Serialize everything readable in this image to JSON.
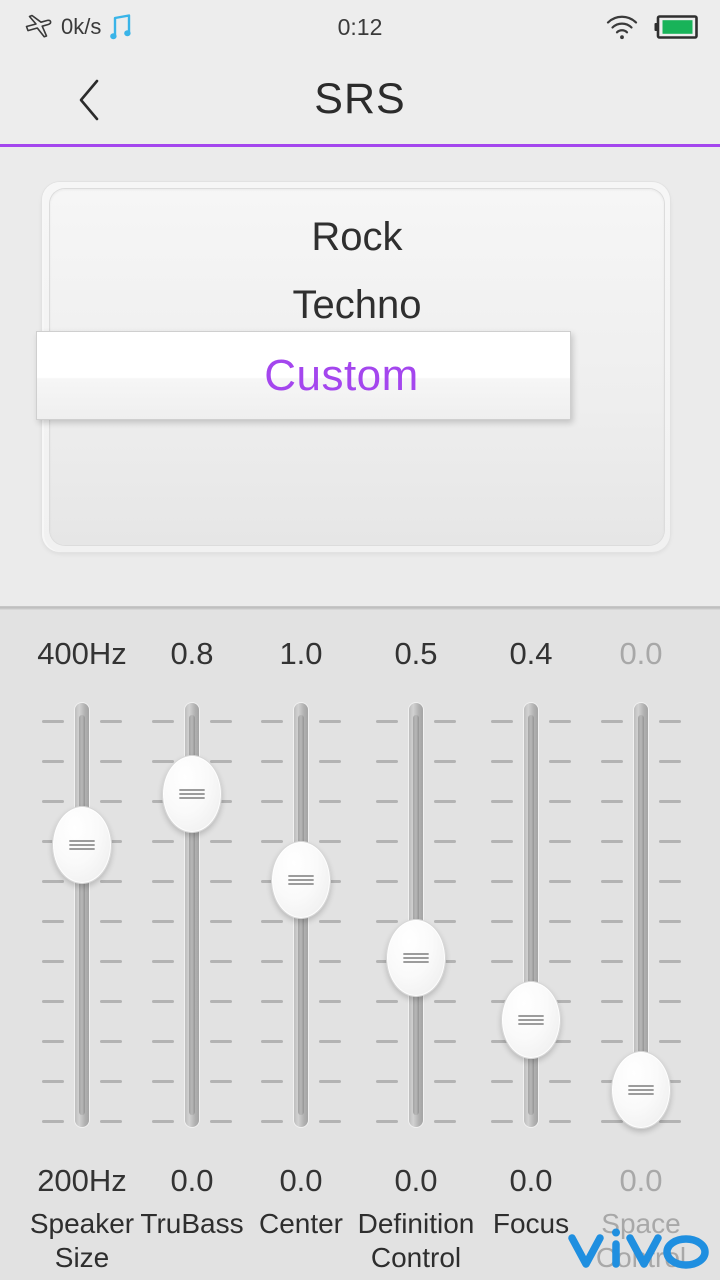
{
  "status_bar": {
    "airplane_icon": "airplane-icon",
    "network_speed": "0k/s",
    "music_icon": "music-note-icon",
    "clock": "0:12",
    "wifi_icon": "wifi-icon",
    "battery_icon": "battery-icon",
    "colors": {
      "music_note": "#39b4e8",
      "battery_fill": "#18b359"
    }
  },
  "header": {
    "back_icon": "back-chevron-icon",
    "title": "SRS",
    "accent_color": "#a446ee"
  },
  "preset_picker": {
    "items": [
      {
        "label": "Rock",
        "selected": false
      },
      {
        "label": "Techno",
        "selected": false
      },
      {
        "label": "Custom",
        "selected": true
      }
    ],
    "selected_label": "Custom",
    "selected_color": "#a446ee"
  },
  "sliders": [
    {
      "name": "Speaker Size",
      "label_line1": "Speaker",
      "label_line2": "Size",
      "top_value": "400Hz",
      "bottom_value": "200Hz",
      "thumb_pct": 33,
      "disabled": false
    },
    {
      "name": "TruBass",
      "label_line1": "TruBass",
      "label_line2": "",
      "top_value": "0.8",
      "bottom_value": "0.0",
      "thumb_pct": 20,
      "disabled": false
    },
    {
      "name": "Center",
      "label_line1": "Center",
      "label_line2": "",
      "top_value": "1.0",
      "bottom_value": "0.0",
      "thumb_pct": 42,
      "disabled": false
    },
    {
      "name": "Definition Control",
      "label_line1": "Definition",
      "label_line2": "Control",
      "top_value": "0.5",
      "bottom_value": "0.0",
      "thumb_pct": 62,
      "disabled": false
    },
    {
      "name": "Focus",
      "label_line1": "Focus",
      "label_line2": "",
      "top_value": "0.4",
      "bottom_value": "0.0",
      "thumb_pct": 78,
      "disabled": false
    },
    {
      "name": "Space Control",
      "label_line1": "Space",
      "label_line2": "Control",
      "top_value": "0.0",
      "bottom_value": "0.0",
      "thumb_pct": 96,
      "disabled": true
    }
  ],
  "watermark": {
    "text": "vivo",
    "color": "#1f8fe0"
  }
}
